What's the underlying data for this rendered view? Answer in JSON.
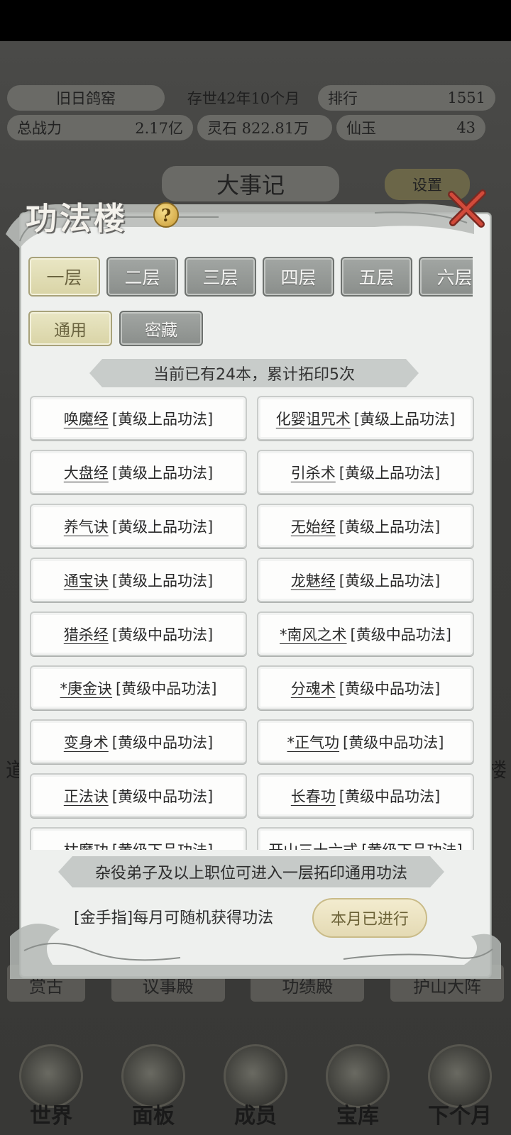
{
  "background": {
    "sect_name": "旧日鸽窑",
    "existence": "存世42年10个月",
    "rank_label": "排行",
    "rank_value": "1551",
    "power_label": "总战力",
    "power_value": "2.17亿",
    "spirit_stone": "灵石 822.81万",
    "jade_label": "仙玉",
    "jade_value": "43",
    "events_label": "大事记",
    "settings_label": "设置",
    "bottom_tabs": [
      "赏古",
      "议事殿",
      "功绩殿",
      "护山大阵"
    ],
    "left_side_text": "道",
    "right_side_text": "楼",
    "nav": [
      "世界",
      "面板",
      "成员",
      "宝库",
      "下个月"
    ]
  },
  "modal": {
    "title": "功法楼",
    "help": "?",
    "floors": [
      "一层",
      "二层",
      "三层",
      "四层",
      "五层",
      "六层"
    ],
    "active_floor": 0,
    "sub_tabs": [
      "通用",
      "密藏"
    ],
    "active_sub_tab": 0,
    "count_text": "当前已有24本，累计拓印5次",
    "techniques": [
      {
        "name": "唤魔经",
        "grade": "[黄级上品功法]"
      },
      {
        "name": "化婴诅咒术",
        "grade": "[黄级上品功法]"
      },
      {
        "name": "大盘经",
        "grade": "[黄级上品功法]"
      },
      {
        "name": "引杀术",
        "grade": "[黄级上品功法]"
      },
      {
        "name": "养气诀",
        "grade": "[黄级上品功法]"
      },
      {
        "name": "无始经",
        "grade": "[黄级上品功法]"
      },
      {
        "name": "通宝诀",
        "grade": "[黄级上品功法]"
      },
      {
        "name": "龙魅经",
        "grade": "[黄级上品功法]"
      },
      {
        "name": "猎杀经",
        "grade": "[黄级中品功法]"
      },
      {
        "name": "*南风之术",
        "grade": "[黄级中品功法]"
      },
      {
        "name": "*庚金诀",
        "grade": "[黄级中品功法]"
      },
      {
        "name": "分魂术",
        "grade": "[黄级中品功法]"
      },
      {
        "name": "变身术",
        "grade": "[黄级中品功法]"
      },
      {
        "name": "*正气功",
        "grade": "[黄级中品功法]"
      },
      {
        "name": "正法诀",
        "grade": "[黄级中品功法]"
      },
      {
        "name": "长春功",
        "grade": "[黄级中品功法]"
      },
      {
        "name": "枯魔功",
        "grade": "[黄级下品功法]"
      },
      {
        "name": "开山三十六式",
        "grade": "[黄级下品功法]"
      }
    ],
    "requirement_text": "杂役弟子及以上职位可进入一层拓印通用功法",
    "golden_finger_text": "[金手指]每月可随机获得功法",
    "done_button": "本月已进行"
  },
  "colors": {
    "tab_active": "#e3dfba",
    "tab_inactive": "#979b98",
    "panel_bg": "#eef0ee",
    "button_gold": "#ece3c2"
  }
}
